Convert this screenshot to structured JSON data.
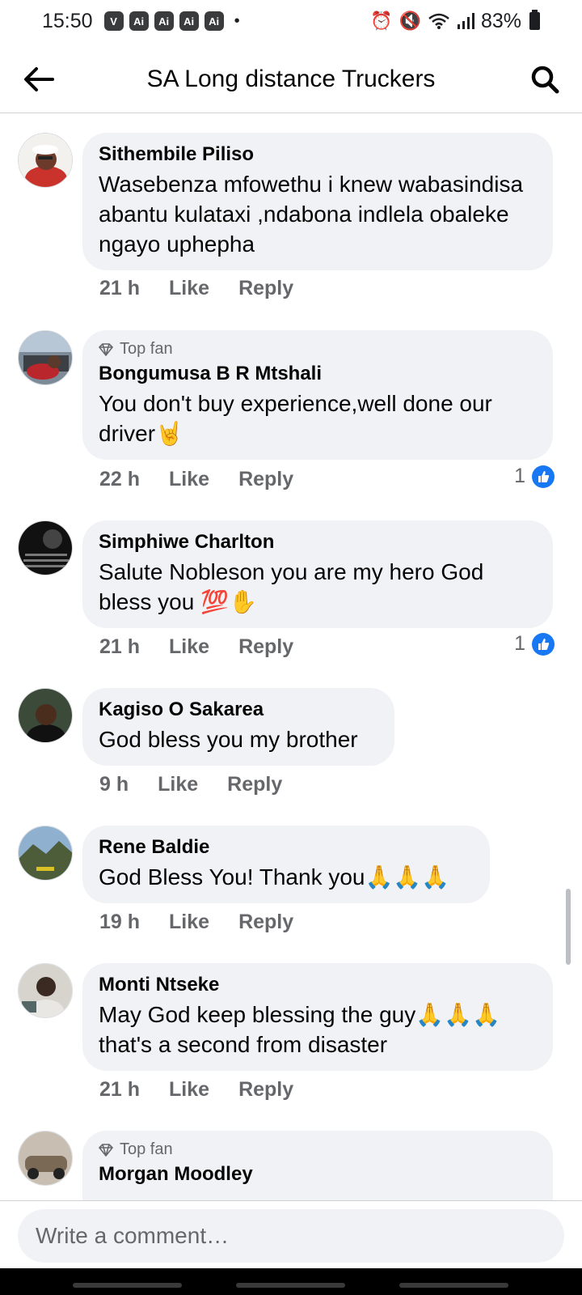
{
  "status_bar": {
    "time": "15:50",
    "badges": [
      "Ai",
      "Ai",
      "Ai",
      "Ai"
    ],
    "battery": "83%"
  },
  "header": {
    "title": "SA Long distance Truckers",
    "back_icon": "arrow-left-icon",
    "search_icon": "search-icon"
  },
  "comments": [
    {
      "author": "Sithembile Piliso",
      "top_fan": false,
      "text": "Wasebenza mfowethu i knew wabasindisa abantu kulataxi  ,ndabona indlela obaleke ngayo uphepha",
      "emoji": "",
      "time": "21 h",
      "like": "Like",
      "reply": "Reply",
      "reactions": ""
    },
    {
      "author": "Bongumusa B R Mtshali",
      "top_fan": true,
      "top_fan_label": "Top fan",
      "text": "You don't buy experience,well done our driver",
      "emoji": "🤘",
      "time": "22 h",
      "like": "Like",
      "reply": "Reply",
      "reactions": "1"
    },
    {
      "author": "Simphiwe Charlton",
      "top_fan": false,
      "text": "Salute Nobleson you are my hero God bless you",
      "emoji": "💯✋",
      "time": "21 h",
      "like": "Like",
      "reply": "Reply",
      "reactions": "1"
    },
    {
      "author": "Kagiso O Sakarea",
      "top_fan": false,
      "text": "God bless you my brother",
      "emoji": "",
      "time": "9 h",
      "like": "Like",
      "reply": "Reply",
      "reactions": ""
    },
    {
      "author": "Rene Baldie",
      "top_fan": false,
      "text": "God Bless You! Thank you",
      "emoji": "🙏🙏🙏",
      "time": "19 h",
      "like": "Like",
      "reply": "Reply",
      "reactions": ""
    },
    {
      "author": "Monti Ntseke",
      "top_fan": false,
      "text": "May God keep blessing  the guy",
      "text2": "that's a second from disaster",
      "emoji": "🙏🙏🙏",
      "time": "21 h",
      "like": "Like",
      "reply": "Reply",
      "reactions": ""
    },
    {
      "author": "Morgan Moodley",
      "top_fan": true,
      "top_fan_label": "Top fan",
      "text": "",
      "emoji": "",
      "time": "",
      "like": "",
      "reply": "",
      "reactions": ""
    }
  ],
  "composer": {
    "placeholder": "Write a comment…"
  },
  "colors": {
    "bubble": "#f0f2f5",
    "meta_text": "#65676b",
    "like_blue": "#1877f2"
  }
}
